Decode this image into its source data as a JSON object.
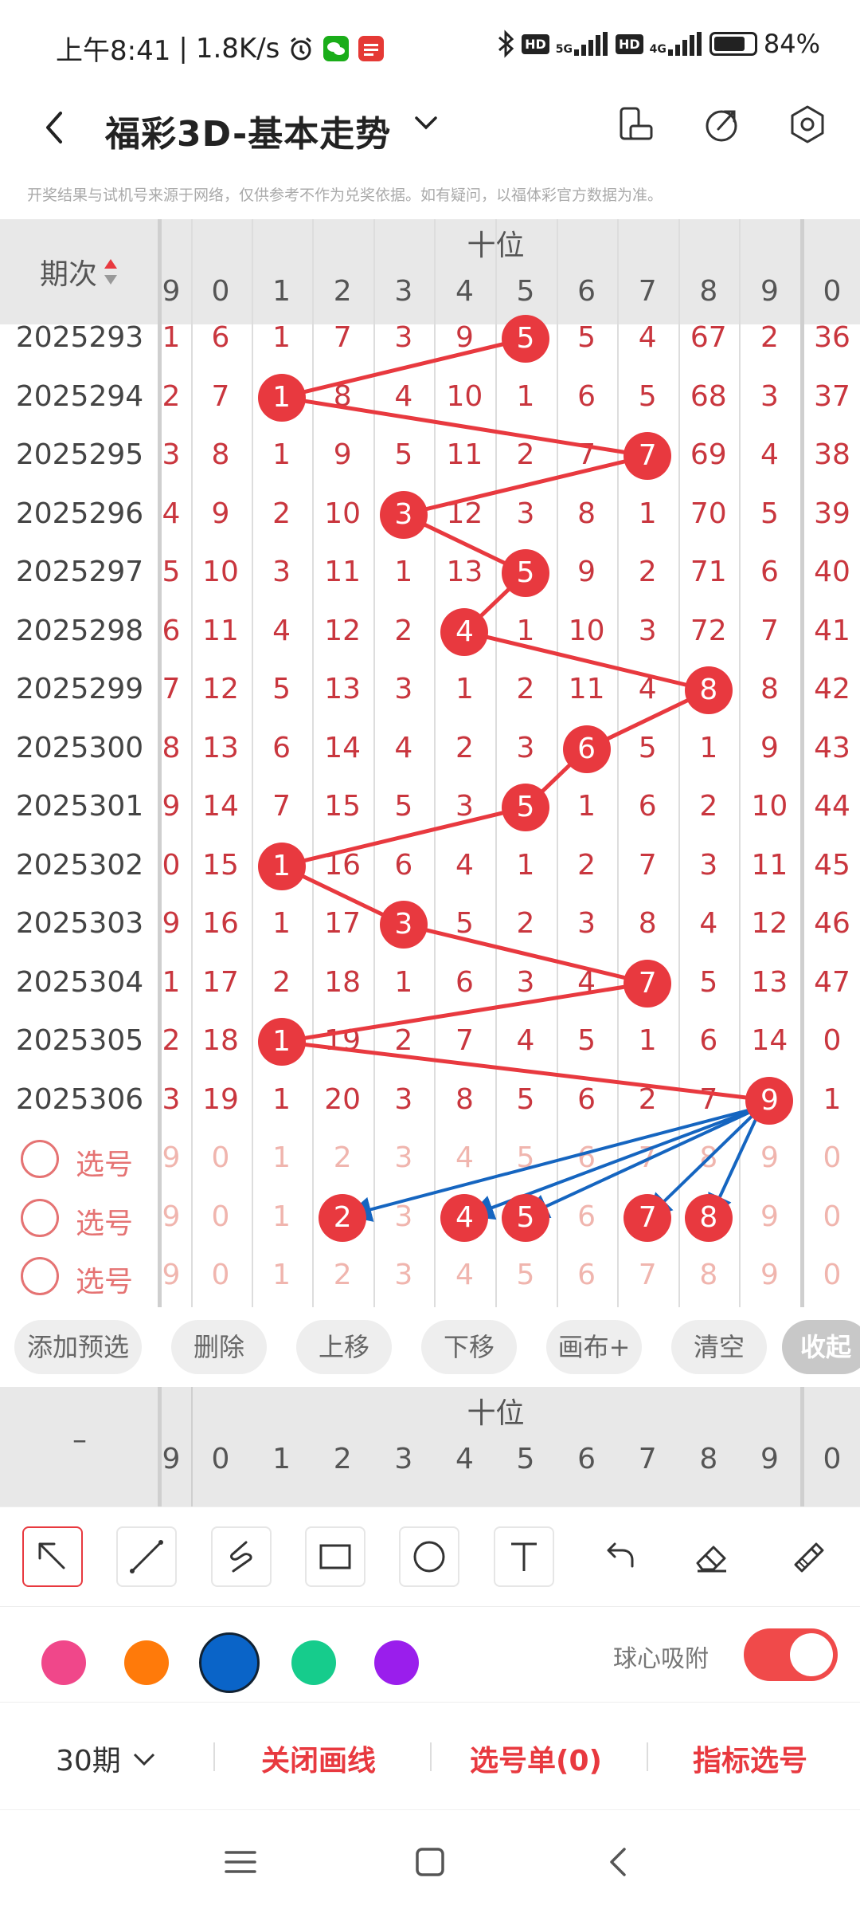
{
  "statusbar": {
    "time": "上午8:41",
    "speed": "1.8K/s",
    "hd": "HD",
    "net_5g": "5G",
    "net_4g": "4G",
    "battery": "84%"
  },
  "header": {
    "title": "福彩3D-基本走势"
  },
  "disclaimer": "开奖结果与试机号来源于网络，仅供参考不作为兑奖依据。如有疑问，以福体彩官方数据为准。",
  "table": {
    "period_header": "期次",
    "group_label": "十位",
    "left_edge_header": "9",
    "digits": [
      "0",
      "1",
      "2",
      "3",
      "4",
      "5",
      "6",
      "7",
      "8",
      "9"
    ],
    "right_edge_header": "0",
    "rows": [
      {
        "period": "2025293",
        "left": "1",
        "cells": [
          "6",
          "1",
          "7",
          "3",
          "9",
          "5",
          "5",
          "4",
          "67",
          "2"
        ],
        "right": "36",
        "hit": 5
      },
      {
        "period": "2025294",
        "left": "2",
        "cells": [
          "7",
          "1",
          "8",
          "4",
          "10",
          "1",
          "6",
          "5",
          "68",
          "3"
        ],
        "right": "37",
        "hit": 1
      },
      {
        "period": "2025295",
        "left": "3",
        "cells": [
          "8",
          "1",
          "9",
          "5",
          "11",
          "2",
          "7",
          "7",
          "69",
          "4"
        ],
        "right": "38",
        "hit": 7
      },
      {
        "period": "2025296",
        "left": "4",
        "cells": [
          "9",
          "2",
          "10",
          "3",
          "12",
          "3",
          "8",
          "1",
          "70",
          "5"
        ],
        "right": "39",
        "hit": 3
      },
      {
        "period": "2025297",
        "left": "5",
        "cells": [
          "10",
          "3",
          "11",
          "1",
          "13",
          "5",
          "9",
          "2",
          "71",
          "6"
        ],
        "right": "40",
        "hit": 5
      },
      {
        "period": "2025298",
        "left": "6",
        "cells": [
          "11",
          "4",
          "12",
          "2",
          "4",
          "1",
          "10",
          "3",
          "72",
          "7"
        ],
        "right": "41",
        "hit": 4
      },
      {
        "period": "2025299",
        "left": "7",
        "cells": [
          "12",
          "5",
          "13",
          "3",
          "1",
          "2",
          "11",
          "4",
          "8",
          "8"
        ],
        "right": "42",
        "hit": 8
      },
      {
        "period": "2025300",
        "left": "8",
        "cells": [
          "13",
          "6",
          "14",
          "4",
          "2",
          "3",
          "6",
          "5",
          "1",
          "9"
        ],
        "right": "43",
        "hit": 6
      },
      {
        "period": "2025301",
        "left": "9",
        "cells": [
          "14",
          "7",
          "15",
          "5",
          "3",
          "5",
          "1",
          "6",
          "2",
          "10"
        ],
        "right": "44",
        "hit": 5
      },
      {
        "period": "2025302",
        "left": "0",
        "cells": [
          "15",
          "1",
          "16",
          "6",
          "4",
          "1",
          "2",
          "7",
          "3",
          "11"
        ],
        "right": "45",
        "hit": 1
      },
      {
        "period": "2025303",
        "left": "9",
        "cells": [
          "16",
          "1",
          "17",
          "3",
          "5",
          "2",
          "3",
          "8",
          "4",
          "12"
        ],
        "right": "46",
        "hit": 3
      },
      {
        "period": "2025304",
        "left": "1",
        "cells": [
          "17",
          "2",
          "18",
          "1",
          "6",
          "3",
          "4",
          "7",
          "5",
          "13"
        ],
        "right": "47",
        "hit": 7
      },
      {
        "period": "2025305",
        "left": "2",
        "cells": [
          "18",
          "1",
          "19",
          "2",
          "7",
          "4",
          "5",
          "1",
          "6",
          "14"
        ],
        "right": "0",
        "hit": 1
      },
      {
        "period": "2025306",
        "left": "3",
        "cells": [
          "19",
          "1",
          "20",
          "3",
          "8",
          "5",
          "6",
          "2",
          "7",
          "9"
        ],
        "right": "1",
        "hit": 9
      }
    ],
    "selection_rows": [
      {
        "label": "选号",
        "left": "9",
        "nums": [
          "0",
          "1",
          "2",
          "3",
          "4",
          "5",
          "6",
          "7",
          "8",
          "9"
        ],
        "right": "0"
      },
      {
        "label": "选号",
        "left": "9",
        "nums": [
          "0",
          "1",
          "2",
          "3",
          "4",
          "5",
          "6",
          "7",
          "8",
          "9"
        ],
        "right": "0",
        "picked": [
          2,
          4,
          5,
          7,
          8
        ]
      },
      {
        "label": "选号",
        "left": "9",
        "nums": [
          "0",
          "1",
          "2",
          "3",
          "4",
          "5",
          "6",
          "7",
          "8",
          "9"
        ],
        "right": "0"
      }
    ]
  },
  "actions": {
    "add": "添加预选",
    "delete": "删除",
    "up": "上移",
    "down": "下移",
    "canvas": "画布+",
    "clear": "清空",
    "collapse": "收起"
  },
  "table2": {
    "period_header": "–",
    "group_label": "十位",
    "left_edge_header": "9",
    "right_edge_header": "0"
  },
  "tools": [
    "arrow-tool",
    "line-tool",
    "freehand-tool",
    "rectangle-tool",
    "circle-tool",
    "text-tool",
    "undo-tool",
    "eraser-tool",
    "clear-brush-tool"
  ],
  "colors": {
    "pink": "#f0478a",
    "orange": "#ff7a0a",
    "blue": "#0a64c8",
    "green": "#16cc8c",
    "purple": "#9a1eec",
    "selected": "blue"
  },
  "snap": {
    "label": "球心吸附",
    "on": true
  },
  "bottombar": {
    "periods": "30期",
    "close_lines": "关闭画线",
    "ticket": "选号单(0)",
    "indicator": "指标选号"
  }
}
